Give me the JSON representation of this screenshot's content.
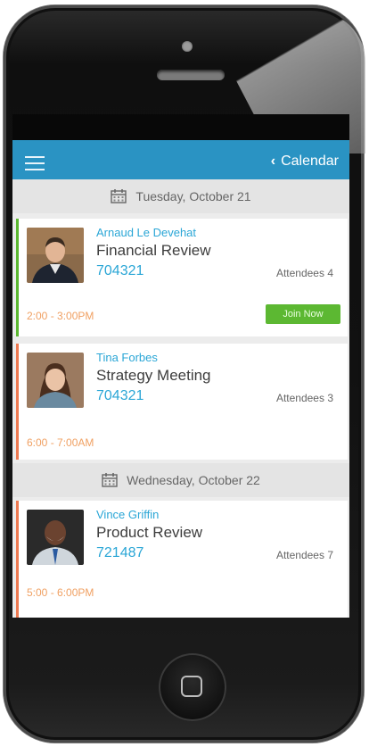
{
  "header": {
    "back_label": "Calendar"
  },
  "days": [
    {
      "label": "Tuesday, October 21",
      "meetings": [
        {
          "host": "Arnaud Le Devehat",
          "title": "Financial Review",
          "code": "704321",
          "attendees": "Attendees 4",
          "time": "2:00 - 3:00PM",
          "action": "Join Now",
          "accent": "#5cb832"
        },
        {
          "host": "Tina Forbes",
          "title": "Strategy Meeting",
          "code": "704321",
          "attendees": "Attendees 3",
          "time": "6:00 - 7:00AM",
          "accent": "#ee7a52"
        }
      ]
    },
    {
      "label": "Wednesday, October 22",
      "meetings": [
        {
          "host": "Vince Griffin",
          "title": "Product Review",
          "code": "721487",
          "attendees": "Attendees 7",
          "time": "5:00 - 6:00PM",
          "accent": "#ee7a52"
        }
      ]
    }
  ],
  "colors": {
    "header_bar": "#2a93c3",
    "link_blue": "#2aa6d6",
    "time_orange": "#f0a062",
    "join_green": "#5cb832"
  },
  "icons": {
    "menu": "hamburger-icon",
    "back": "chevron-left-icon",
    "calendar": "calendar-icon"
  }
}
